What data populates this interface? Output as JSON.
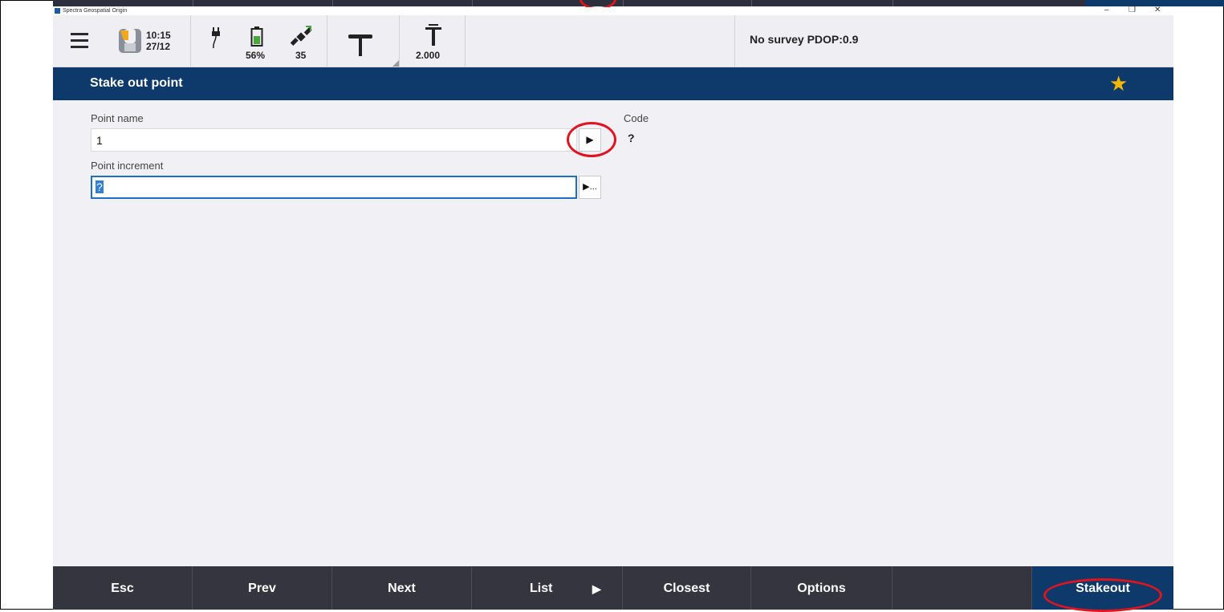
{
  "window": {
    "title": "Spectra Geospatial Origin",
    "controls": [
      "–",
      "❐",
      "✕"
    ]
  },
  "status_bar": {
    "time": "10:15",
    "date": "27/12",
    "battery": "56%",
    "satellites": "35",
    "antenna_height": "2.000",
    "survey_status": "No survey  PDOP:0.9"
  },
  "page": {
    "title": "Stake out point"
  },
  "form": {
    "point_name_label": "Point name",
    "point_name_value": "1",
    "point_increment_label": "Point increment",
    "point_increment_value": "?",
    "code_label": "Code",
    "code_value": "?",
    "point_name_arrow": "▶",
    "point_increment_arrow": "▶..."
  },
  "softkeys": {
    "esc": "Esc",
    "prev": "Prev",
    "next": "Next",
    "list": "List",
    "list_arrow": "▶",
    "closest": "Closest",
    "options": "Options",
    "stakeout": "Stakeout"
  },
  "colors": {
    "header_blue": "#0d3a6b",
    "softkey_bar": "#34353f",
    "highlight_ellipse": "#e0141e",
    "favorite_star": "#f5b800"
  },
  "icons": [
    "menu-icon",
    "app-logo-icon",
    "power-plug-icon",
    "battery-icon",
    "satellite-icon",
    "receiver-icon",
    "pole-icon",
    "star-icon"
  ]
}
